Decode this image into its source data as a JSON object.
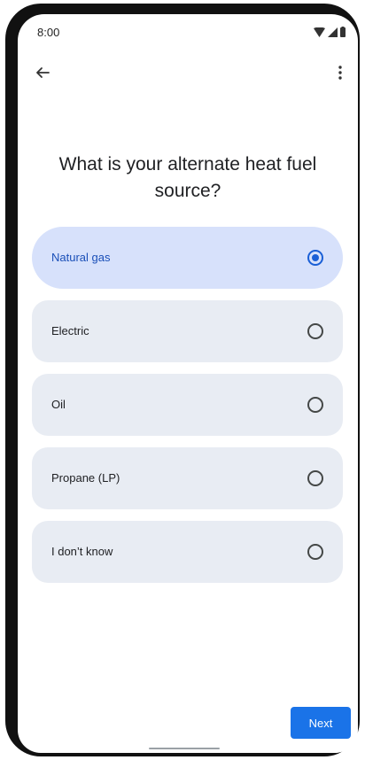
{
  "status_bar": {
    "time": "8:00",
    "icons": [
      "wifi-icon",
      "signal-icon",
      "battery-icon"
    ]
  },
  "app_bar": {
    "back_icon": "arrow-back-icon",
    "menu_icon": "more-vert-icon"
  },
  "question": "What is your alternate heat fuel source?",
  "options": [
    {
      "label": "Natural gas",
      "selected": true
    },
    {
      "label": "Electric",
      "selected": false
    },
    {
      "label": "Oil",
      "selected": false
    },
    {
      "label": "Propane (LP)",
      "selected": false
    },
    {
      "label": "I don’t know",
      "selected": false
    }
  ],
  "next_button": "Next",
  "colors": {
    "accent": "#1a73e8",
    "selected_background": "#d7e1fb",
    "option_background": "#e8ecf3"
  }
}
